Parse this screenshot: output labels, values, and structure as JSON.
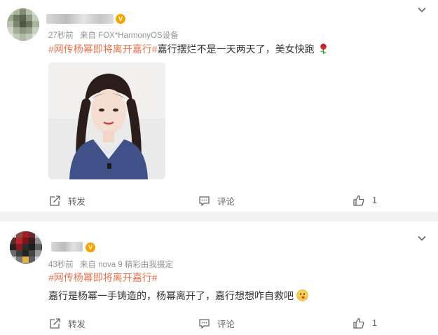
{
  "posts": [
    {
      "time": "27秒前",
      "source": "来自 FOX*HarmonyOS设备",
      "hashtag": "#网传杨幂即将离开嘉行#",
      "text": "嘉行摆烂不是一天两天了，美女快跑",
      "emoji": "rose-icon",
      "has_image": true,
      "actions": {
        "repost": "转发",
        "comment": "评论",
        "like_count": "1"
      }
    },
    {
      "time": "43秒前",
      "source": "来自 nova 9 精彩由我掇定",
      "hashtag": "#网传杨幂即将离开嘉行#",
      "text": "嘉行是杨幂一手铸造的，杨幂离开了，嘉行想想咋自救吧",
      "emoji": "thinking-face-icon",
      "has_image": false,
      "actions": {
        "repost": "转发",
        "comment": "评论",
        "like_count": "1"
      }
    }
  ],
  "colors": {
    "hashtag": "#eb7350",
    "meta": "#939393",
    "separator": "#f2f2f2",
    "vip_badge": "#f7a400"
  }
}
